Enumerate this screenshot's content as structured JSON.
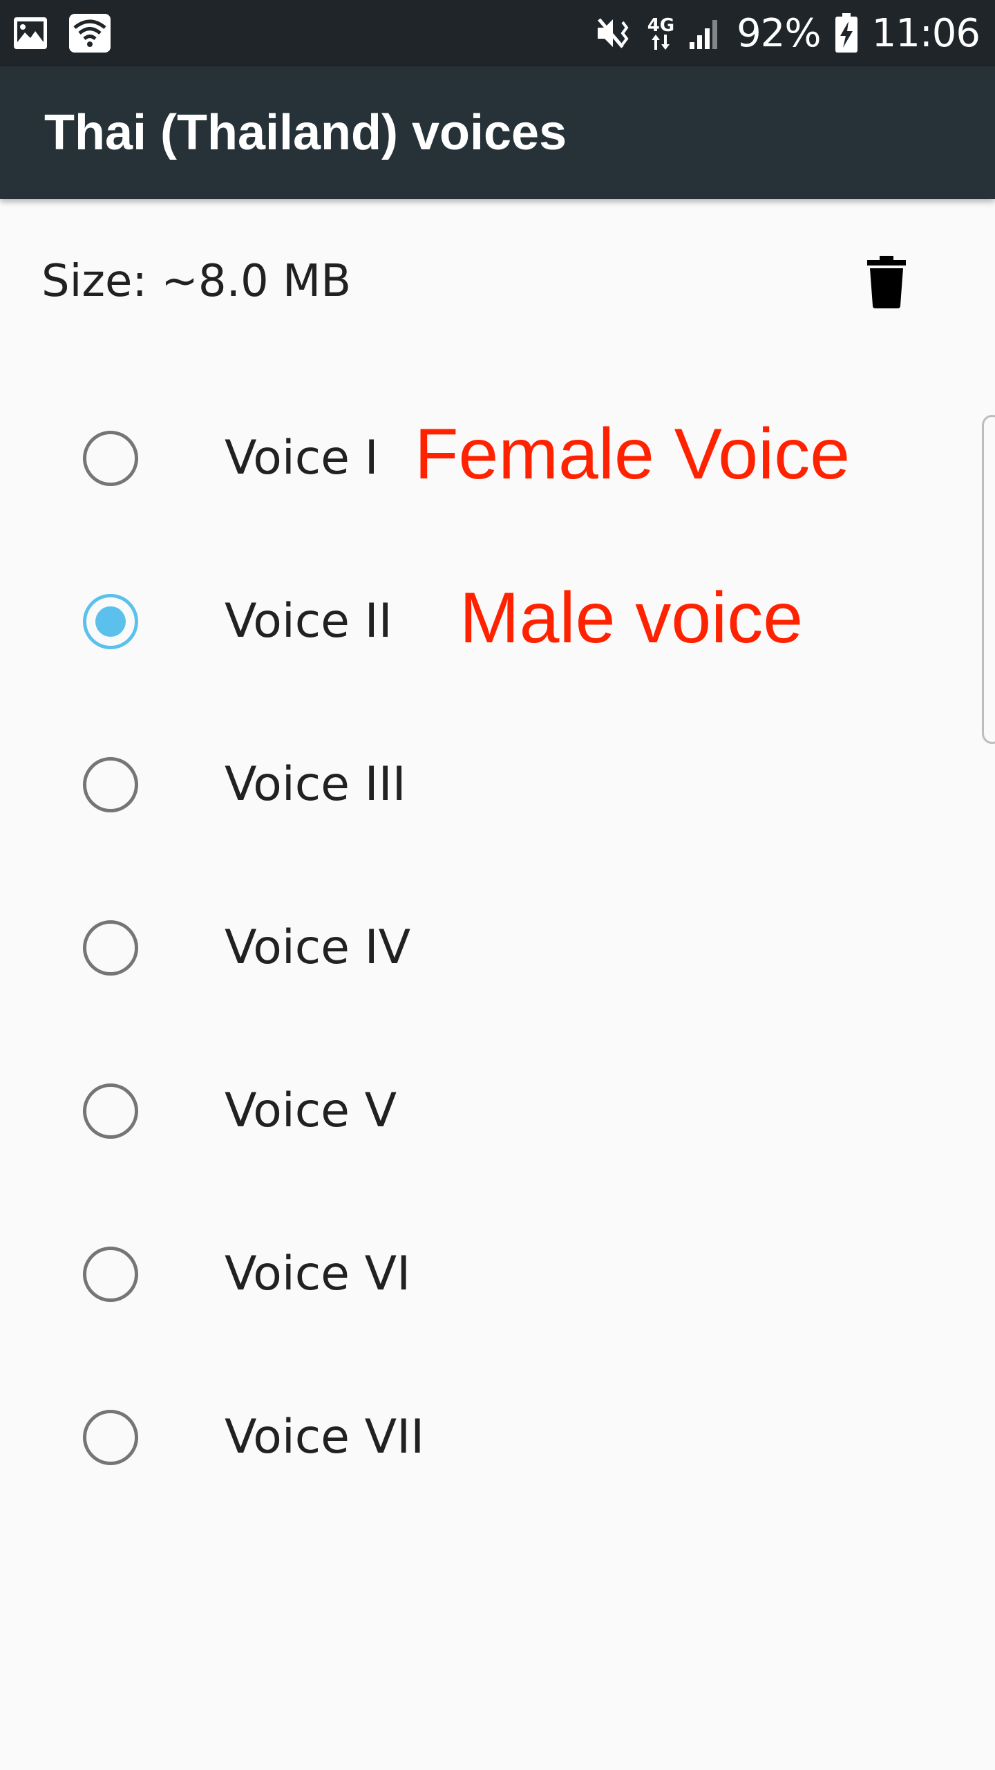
{
  "status_bar": {
    "battery": "92%",
    "time": "11:06",
    "network_type": "4G",
    "icons": [
      "gallery-icon",
      "wifi-icon",
      "mute-vibrate-icon",
      "network-4g-icon",
      "signal-icon",
      "battery-charging-icon"
    ]
  },
  "app_bar": {
    "title": "Thai (Thailand) voices"
  },
  "pack": {
    "size_label": "Size: ~8.0 MB",
    "delete_icon": "trash-icon"
  },
  "voices": [
    {
      "label": "Voice I",
      "selected": false
    },
    {
      "label": "Voice II",
      "selected": true
    },
    {
      "label": "Voice III",
      "selected": false
    },
    {
      "label": "Voice IV",
      "selected": false
    },
    {
      "label": "Voice V",
      "selected": false
    },
    {
      "label": "Voice VI",
      "selected": false
    },
    {
      "label": "Voice VII",
      "selected": false
    }
  ],
  "annotations": {
    "female": "Female Voice",
    "male": "Male voice"
  },
  "colors": {
    "status_bar_bg": "#1f2529",
    "app_bar_bg": "#263238",
    "accent": "#5bc0eb",
    "annotation": "#ff2200",
    "background": "#fafafa"
  }
}
